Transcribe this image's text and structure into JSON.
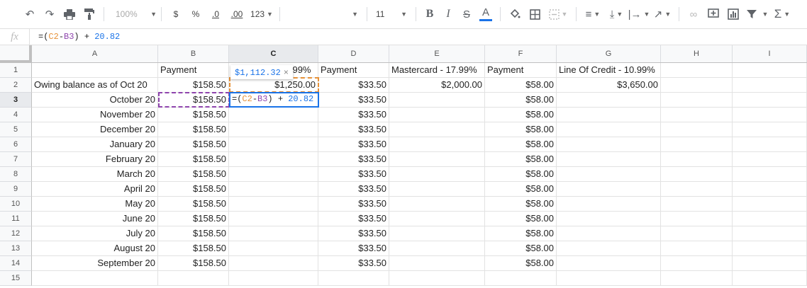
{
  "toolbar": {
    "zoom": "100%",
    "currency": "$",
    "percent": "%",
    "dec_decrease": ".0",
    "dec_increase": ".00",
    "more_formats": "123",
    "font_size": "11"
  },
  "formula_bar": {
    "fx_label": "fx",
    "parts": [
      "=(",
      "C2",
      "-",
      "B3",
      ") + ",
      "20.82"
    ]
  },
  "columns": [
    "A",
    "B",
    "C",
    "D",
    "E",
    "F",
    "G",
    "H",
    "I"
  ],
  "rows": [
    "1",
    "2",
    "3",
    "4",
    "5",
    "6",
    "7",
    "8",
    "9",
    "10",
    "11",
    "12",
    "13",
    "14",
    "15"
  ],
  "cells": {
    "B1": "Payment",
    "C1": "Visa Card - 19.99%",
    "D1": "Payment",
    "E1": "Mastercard - 17.99%",
    "F1": "Payment",
    "G1": "Line Of Credit - 10.99%",
    "A2": "Owing balance as of Oct 20",
    "B2": "$158.50",
    "C2": "$1,250.00",
    "D2": "$33.50",
    "E2": "$2,000.00",
    "F2": "$58.00",
    "G2": "$3,650.00",
    "A3": "October 20",
    "B3": "$158.50",
    "D3": "$33.50",
    "F3": "$58.00",
    "A4": "November 20",
    "B4": "$158.50",
    "D4": "$33.50",
    "F4": "$58.00",
    "A5": "December 20",
    "B5": "$158.50",
    "D5": "$33.50",
    "F5": "$58.00",
    "A6": "January 20",
    "B6": "$158.50",
    "D6": "$33.50",
    "F6": "$58.00",
    "A7": "February 20",
    "B7": "$158.50",
    "D7": "$33.50",
    "F7": "$58.00",
    "A8": "March 20",
    "B8": "$158.50",
    "D8": "$33.50",
    "F8": "$58.00",
    "A9": "April 20",
    "B9": "$158.50",
    "D9": "$33.50",
    "F9": "$58.00",
    "A10": "May 20",
    "B10": "$158.50",
    "D10": "$33.50",
    "F10": "$58.00",
    "A11": "June 20",
    "B11": "$158.50",
    "D11": "$33.50",
    "F11": "$58.00",
    "A12": "July 20",
    "B12": "$158.50",
    "D12": "$33.50",
    "F12": "$58.00",
    "A13": "August 20",
    "B13": "$158.50",
    "D13": "$33.50",
    "F13": "$58.00",
    "A14": "September 20",
    "B14": "$158.50",
    "D14": "$33.50",
    "F14": "$58.00"
  },
  "active_cell": {
    "ref": "C3",
    "preview_value": "$1,112.32",
    "close": "×"
  },
  "colors": {
    "c2_ref": "#e69138",
    "b3_ref": "#8e44ad",
    "active": "#1a73e8"
  }
}
